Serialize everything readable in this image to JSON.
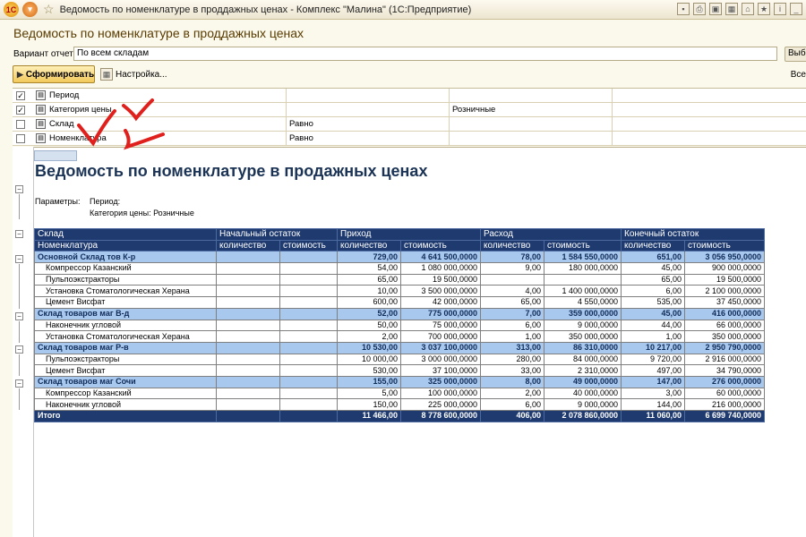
{
  "window": {
    "title": "Ведомость по номенклатуре в проддажных ценах - Комплекс \"Малина\"  (1С:Предприятие)",
    "logo": "1С"
  },
  "form": {
    "title": "Ведомость по номенклатуре в проддажных ценах",
    "variant_label": "Вариант отчета:",
    "variant_value": "По всем складам",
    "select_label": "Выбрать",
    "generate_label": "Сформировать",
    "settings_label": "Настройка...",
    "all_label": "Все"
  },
  "settings": [
    {
      "checked": true,
      "name": "Период",
      "condition": "",
      "value": ""
    },
    {
      "checked": true,
      "name": "Категория цены",
      "condition": "",
      "value": "Розничные"
    },
    {
      "checked": false,
      "name": "Склад",
      "condition": "Равно",
      "value": ""
    },
    {
      "checked": false,
      "name": "Номенклатура",
      "condition": "Равно",
      "value": ""
    }
  ],
  "report": {
    "title": "Ведомость по номенклатуре в продажных ценах",
    "params_label": "Параметры:",
    "param_period": "Период:",
    "param_category": "Категория цены: Розничные",
    "header1": [
      "Склад",
      "Начальный остаток",
      "Приход",
      "Расход",
      "Конечный остаток"
    ],
    "header2": [
      "Номенклатура",
      "количество",
      "стоимость",
      "количество",
      "стоимость",
      "количество",
      "стоимость",
      "количество",
      "стоимость"
    ],
    "rows": [
      {
        "type": "group",
        "name": "Основной Склад тов К-р",
        "cells": [
          "",
          "",
          "729,00",
          "4 641 500,0000",
          "78,00",
          "1 584 550,0000",
          "651,00",
          "3 056 950,0000"
        ]
      },
      {
        "type": "item",
        "name": "Компрессор Казанский",
        "cells": [
          "",
          "",
          "54,00",
          "1 080 000,0000",
          "9,00",
          "180 000,0000",
          "45,00",
          "900 000,0000"
        ]
      },
      {
        "type": "item",
        "name": "Пульпоэкстракторы",
        "cells": [
          "",
          "",
          "65,00",
          "19 500,0000",
          "",
          "",
          "65,00",
          "19 500,0000"
        ]
      },
      {
        "type": "item",
        "name": "Установка Стоматологическая Херана",
        "cells": [
          "",
          "",
          "10,00",
          "3 500 000,0000",
          "4,00",
          "1 400 000,0000",
          "6,00",
          "2 100 000,0000"
        ]
      },
      {
        "type": "item",
        "name": "Цемент Висфат",
        "cells": [
          "",
          "",
          "600,00",
          "42 000,0000",
          "65,00",
          "4 550,0000",
          "535,00",
          "37 450,0000"
        ]
      },
      {
        "type": "group",
        "name": "Склад товаров маг В-д",
        "cells": [
          "",
          "",
          "52,00",
          "775 000,0000",
          "7,00",
          "359 000,0000",
          "45,00",
          "416 000,0000"
        ]
      },
      {
        "type": "item",
        "name": "Наконечник угловой",
        "cells": [
          "",
          "",
          "50,00",
          "75 000,0000",
          "6,00",
          "9 000,0000",
          "44,00",
          "66 000,0000"
        ]
      },
      {
        "type": "item",
        "name": "Установка Стоматологическая Херана",
        "cells": [
          "",
          "",
          "2,00",
          "700 000,0000",
          "1,00",
          "350 000,0000",
          "1,00",
          "350 000,0000"
        ]
      },
      {
        "type": "group",
        "name": "Склад товаров маг Р-в",
        "cells": [
          "",
          "",
          "10 530,00",
          "3 037 100,0000",
          "313,00",
          "86 310,0000",
          "10 217,00",
          "2 950 790,0000"
        ]
      },
      {
        "type": "item",
        "name": "Пульпоэкстракторы",
        "cells": [
          "",
          "",
          "10 000,00",
          "3 000 000,0000",
          "280,00",
          "84 000,0000",
          "9 720,00",
          "2 916 000,0000"
        ]
      },
      {
        "type": "item",
        "name": "Цемент Висфат",
        "cells": [
          "",
          "",
          "530,00",
          "37 100,0000",
          "33,00",
          "2 310,0000",
          "497,00",
          "34 790,0000"
        ]
      },
      {
        "type": "group",
        "name": "Склад товаров маг Сочи",
        "cells": [
          "",
          "",
          "155,00",
          "325 000,0000",
          "8,00",
          "49 000,0000",
          "147,00",
          "276 000,0000"
        ]
      },
      {
        "type": "item",
        "name": "Компрессор Казанский",
        "cells": [
          "",
          "",
          "5,00",
          "100 000,0000",
          "2,00",
          "40 000,0000",
          "3,00",
          "60 000,0000"
        ]
      },
      {
        "type": "item",
        "name": "Наконечник угловой",
        "cells": [
          "",
          "",
          "150,00",
          "225 000,0000",
          "6,00",
          "9 000,0000",
          "144,00",
          "216 000,0000"
        ]
      },
      {
        "type": "total",
        "name": "Итого",
        "cells": [
          "",
          "",
          "11 466,00",
          "8 778 600,0000",
          "406,00",
          "2 078 860,0000",
          "11 060,00",
          "6 699 740,0000"
        ]
      }
    ]
  },
  "colors": {
    "header_bg": "#1e3a6e",
    "group_bg": "#a9c8ee",
    "title_color": "#1b3355",
    "annotation": "#e0201c"
  }
}
